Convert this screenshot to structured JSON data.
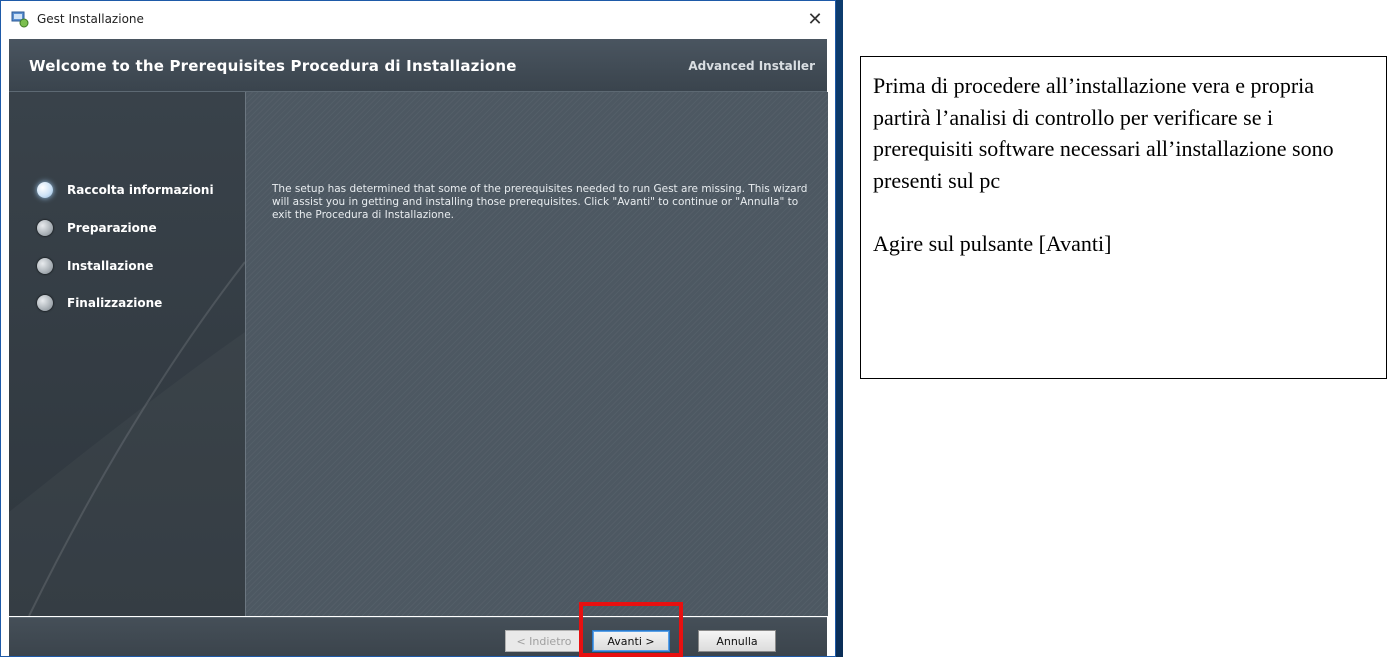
{
  "window": {
    "title": "Gest Installazione",
    "close_glyph": "✕"
  },
  "header": {
    "title": "Welcome to the Prerequisites Procedura di Installazione",
    "brand": "Advanced Installer"
  },
  "steps": [
    {
      "label": "Raccolta informazioni",
      "active": true
    },
    {
      "label": "Preparazione",
      "active": false
    },
    {
      "label": "Installazione",
      "active": false
    },
    {
      "label": "Finalizzazione",
      "active": false
    }
  ],
  "content": {
    "message": "The setup has determined that some of the prerequisites needed to run Gest are missing. This wizard will assist you in getting and installing those prerequisites. Click \"Avanti\" to continue or \"Annulla\" to exit the Procedura di Installazione."
  },
  "buttons": {
    "back": "< Indietro",
    "next": "Avanti >",
    "cancel": "Annulla"
  },
  "note": {
    "description": "Prima di procedere all’installazione vera e propria partirà l’analisi di controllo per verificare se i prerequisiti software necessari all’installazione sono presenti sul pc",
    "action": "Agire sul pulsante [Avanti]"
  },
  "colors": {
    "highlight": "#e81010",
    "panel": "#4d5862",
    "header": "#4a5560"
  },
  "icons": {
    "app": "installer-icon",
    "close": "close-icon"
  }
}
